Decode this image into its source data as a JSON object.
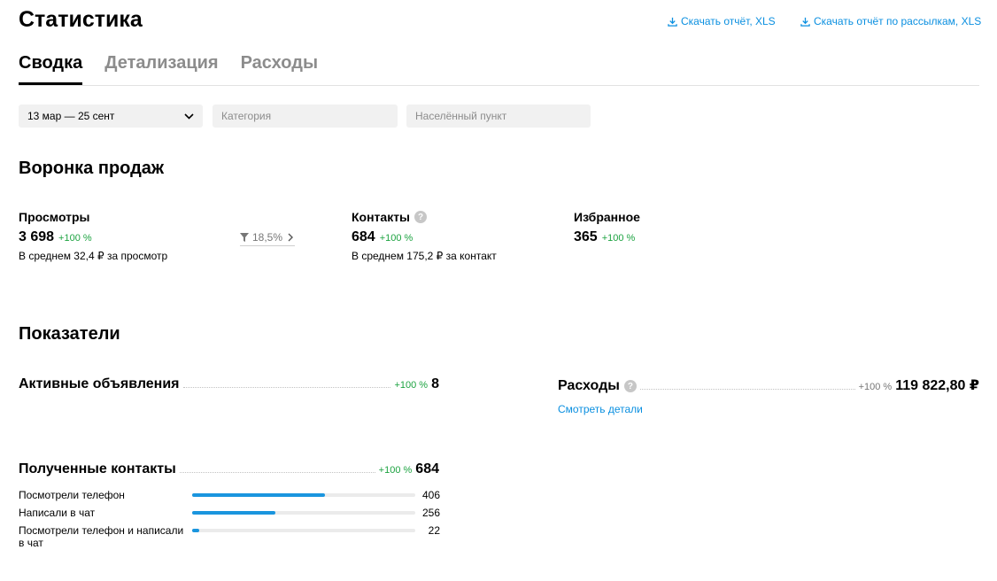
{
  "header": {
    "title": "Статистика",
    "download_report": "Скачать отчёт, XLS",
    "download_mailing_report": "Скачать отчёт по рассылкам, XLS"
  },
  "tabs": [
    {
      "label": "Сводка",
      "active": true
    },
    {
      "label": "Детализация",
      "active": false
    },
    {
      "label": "Расходы",
      "active": false
    }
  ],
  "filters": {
    "date_range": "13 мар — 25 сент",
    "category_placeholder": "Категория",
    "city_placeholder": "Населённый пункт"
  },
  "funnel": {
    "title": "Воронка продаж",
    "views": {
      "label": "Просмотры",
      "value": "3 698",
      "change": "+100 %",
      "sub": "В среднем 32,4 ₽ за просмотр"
    },
    "conversion": "18,5%",
    "contacts": {
      "label": "Контакты",
      "value": "684",
      "change": "+100 %",
      "sub": "В среднем 175,2 ₽ за контакт"
    },
    "favorites": {
      "label": "Избранное",
      "value": "365",
      "change": "+100 %"
    }
  },
  "metrics": {
    "title": "Показатели",
    "active_ads": {
      "label": "Активные объявления",
      "change": "+100 %",
      "value": "8"
    },
    "expenses": {
      "label": "Расходы",
      "change": "+100 %",
      "value": "119 822,80 ₽",
      "details_link": "Смотреть детали"
    },
    "received_contacts": {
      "label": "Полученные контакты",
      "change": "+100 %",
      "value": "684",
      "breakdown": [
        {
          "label": "Посмотрели телефон",
          "value": "406",
          "share": 0.594
        },
        {
          "label": "Написали в чат",
          "value": "256",
          "share": 0.374
        },
        {
          "label": "Посмотрели телефон и написали в чат",
          "value": "22",
          "share": 0.032
        }
      ]
    }
  },
  "colors": {
    "link": "#0a8fe0",
    "positive": "#1da341",
    "bar": "#1a95de"
  }
}
